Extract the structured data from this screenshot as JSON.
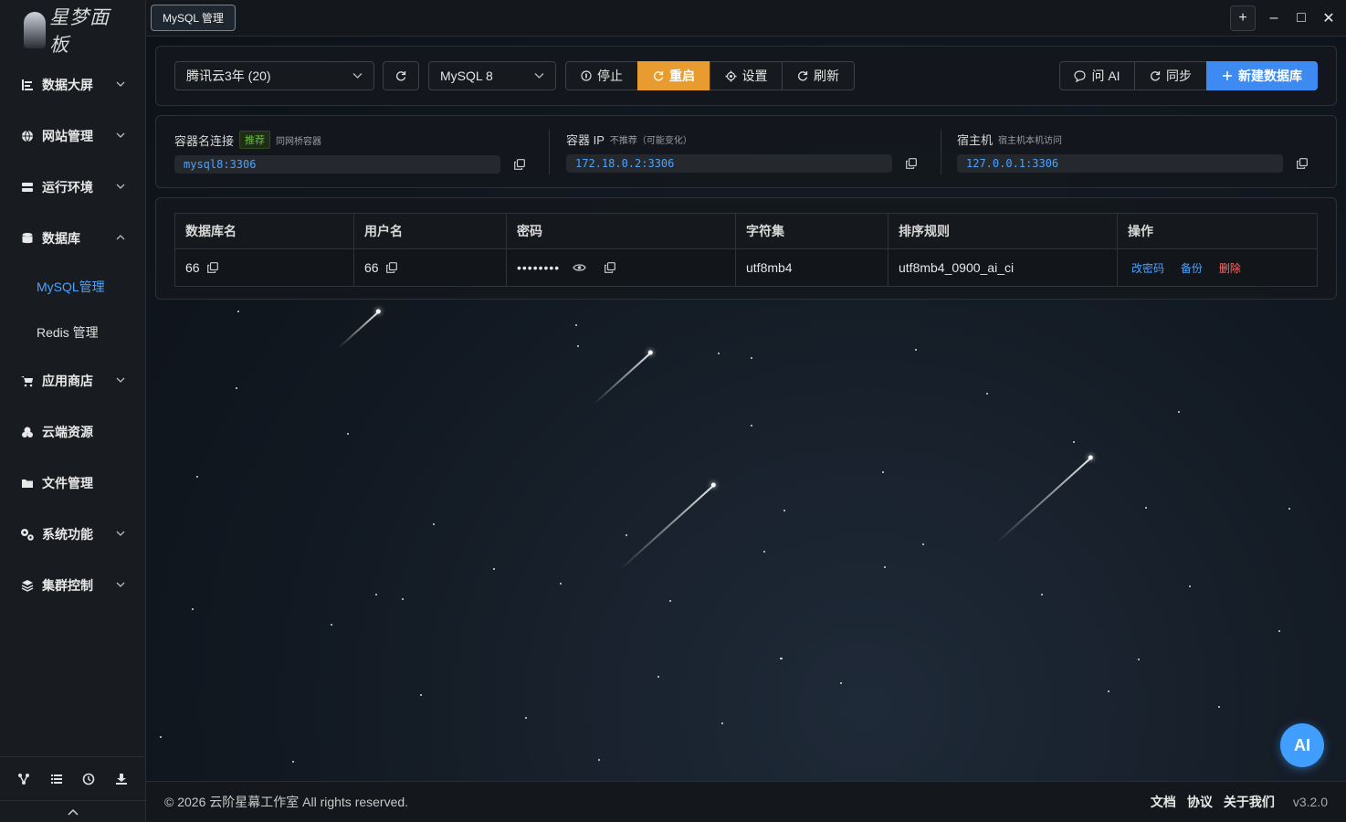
{
  "app": {
    "logo_text": "星梦面板"
  },
  "sidebar": {
    "items": [
      {
        "label": "数据大屏",
        "icon": "bar-chart-icon"
      },
      {
        "label": "网站管理",
        "icon": "globe-icon"
      },
      {
        "label": "运行环境",
        "icon": "server-icon"
      },
      {
        "label": "数据库",
        "icon": "database-icon"
      },
      {
        "label": "应用商店",
        "icon": "cart-icon"
      },
      {
        "label": "云端资源",
        "icon": "cloud-icon"
      },
      {
        "label": "文件管理",
        "icon": "folder-icon"
      },
      {
        "label": "系统功能",
        "icon": "gears-icon"
      },
      {
        "label": "集群控制",
        "icon": "layers-icon"
      }
    ],
    "sub_items": [
      {
        "label": "MySQL管理",
        "active": true
      },
      {
        "label": "Redis 管理",
        "active": false
      }
    ],
    "bottom_icons": [
      "share-icon",
      "list-icon",
      "history-icon",
      "download-icon"
    ]
  },
  "topbar": {
    "tab_label": "MySQL 管理",
    "window_buttons": [
      "+",
      "–",
      "□",
      "✕"
    ]
  },
  "toolbar": {
    "server_select": "腾讯云3年 (20)",
    "version_select": "MySQL 8",
    "stop_label": "停止",
    "restart_label": "重启",
    "settings_label": "设置",
    "refresh_label": "刷新",
    "ask_ai_label": "问 AI",
    "sync_label": "同步",
    "new_db_label": "新建数据库"
  },
  "connections": {
    "container": {
      "title": "容器名连接",
      "tag": "推荐",
      "hint": "同网桥容器",
      "value": "mysql8:3306"
    },
    "ip": {
      "title": "容器 IP",
      "hint": "不推荐（可能变化）",
      "value": "172.18.0.2:3306"
    },
    "host": {
      "title": "宿主机",
      "hint": "宿主机本机访问",
      "value": "127.0.0.1:3306"
    }
  },
  "table": {
    "headers": [
      "数据库名",
      "用户名",
      "密码",
      "字符集",
      "排序规则",
      "操作"
    ],
    "rows": [
      {
        "name": "66",
        "user": "66",
        "password": "••••••••",
        "charset": "utf8mb4",
        "collation": "utf8mb4_0900_ai_ci"
      }
    ],
    "actions": {
      "change_password": "改密码",
      "backup": "备份",
      "delete": "删除"
    }
  },
  "ai_button": "AI",
  "footer": {
    "copyright": "© 2026 云阶星幕工作室 All rights reserved.",
    "docs": "文档",
    "agreement": "协议",
    "about": "关于我们",
    "version": "v3.2.0"
  },
  "colors": {
    "accent_blue": "#409eff",
    "restart_orange": "#e89b2e",
    "danger_red": "#f56c6c",
    "recommend_green": "#67c23a"
  }
}
